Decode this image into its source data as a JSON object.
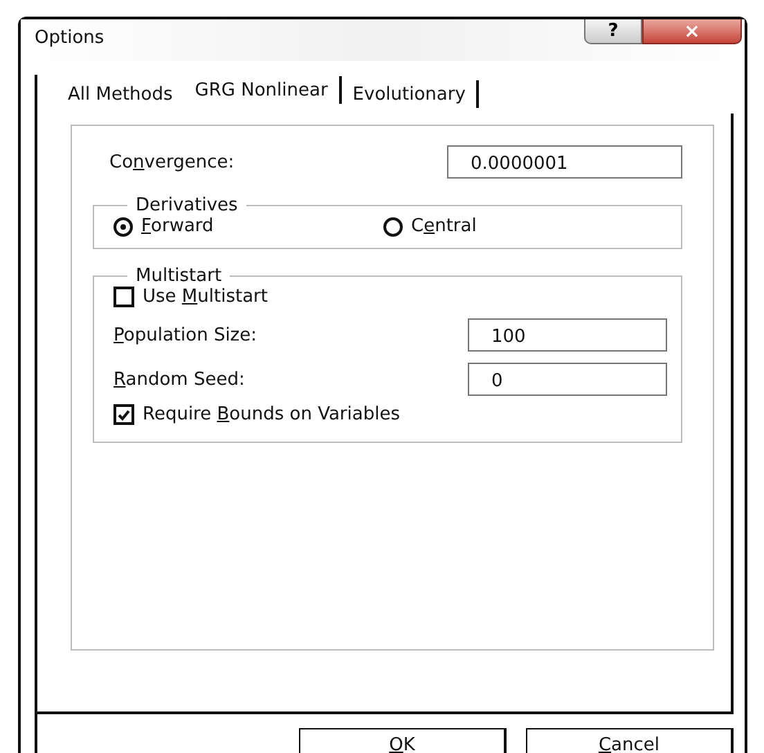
{
  "window": {
    "title": "Options",
    "help_button": "?",
    "close_button": "×"
  },
  "tabs": [
    {
      "label": "All Methods",
      "selected": false
    },
    {
      "label": "GRG Nonlinear",
      "selected": true
    },
    {
      "label": "Evolutionary",
      "selected": false
    }
  ],
  "convergence": {
    "label": {
      "before": "Co",
      "key": "n",
      "after": "vergence:"
    },
    "value": "0.0000001"
  },
  "derivatives": {
    "title": "Derivatives",
    "options": [
      {
        "label": {
          "key": "F",
          "after": "orward"
        },
        "selected": true
      },
      {
        "label": {
          "before": "C",
          "key": "e",
          "after": "ntral"
        },
        "selected": false
      }
    ]
  },
  "multistart": {
    "title": "Multistart",
    "use_multistart": {
      "label": {
        "before": "Use ",
        "key": "M",
        "after": "ultistart"
      },
      "checked": false
    },
    "population_size": {
      "label": {
        "key": "P",
        "after": "opulation Size:"
      },
      "value": "100"
    },
    "random_seed": {
      "label": {
        "key": "R",
        "after": "andom Seed:"
      },
      "value": "0"
    },
    "require_bounds": {
      "label": {
        "before": "Require ",
        "key": "B",
        "after": "ounds on Variables"
      },
      "checked": true
    }
  },
  "buttons": [
    {
      "label": {
        "key": "O",
        "after": "K"
      }
    },
    {
      "label": {
        "key": "C",
        "after": "ancel"
      }
    }
  ]
}
